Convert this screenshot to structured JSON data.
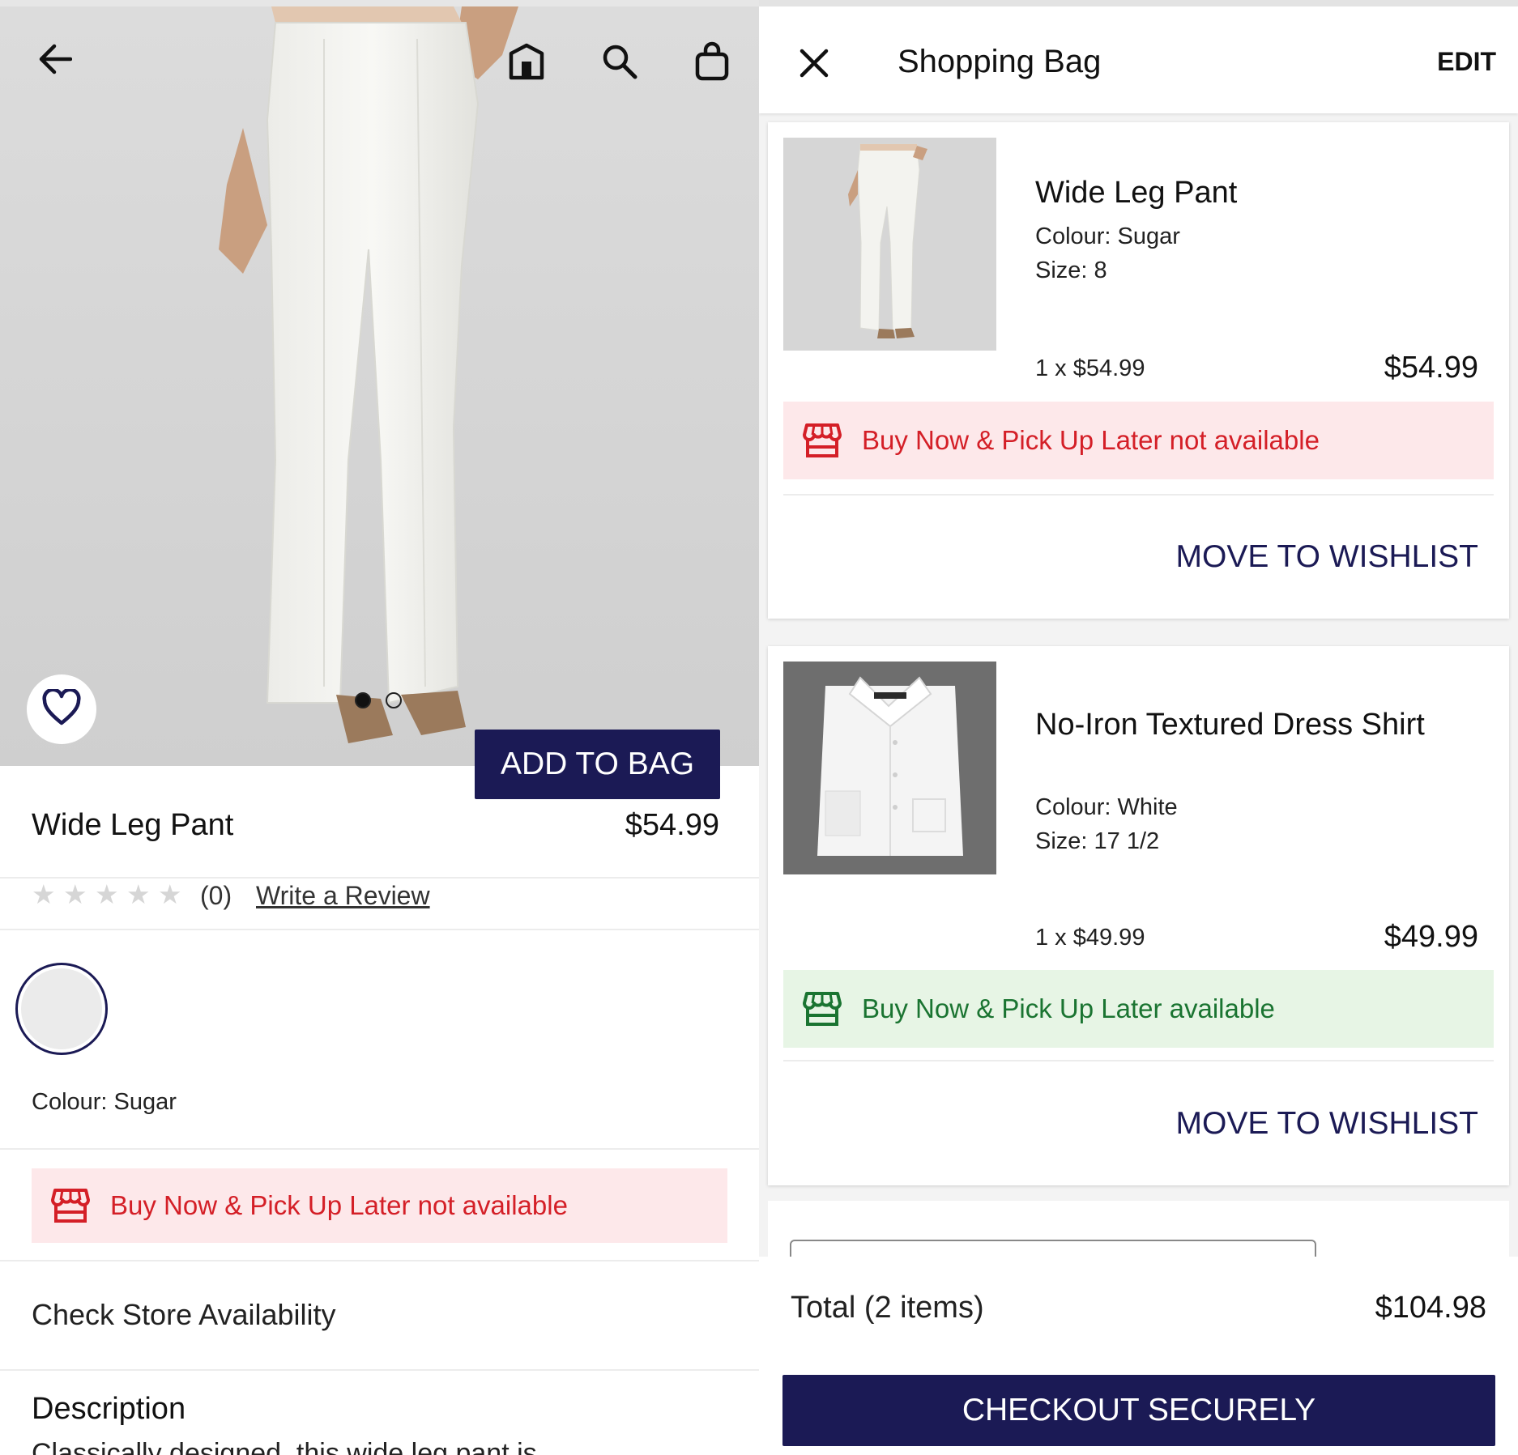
{
  "product_page": {
    "title": "Wide Leg Pant",
    "price": "$54.99",
    "rating": {
      "stars": 0,
      "max": 5,
      "count_text": "(0)",
      "write_review": "Write a Review"
    },
    "colour_label": "Colour: Sugar",
    "image_dots": {
      "count": 2,
      "active": 1
    },
    "add_to_bag": "ADD TO BAG",
    "bopis": "Buy Now & Pick Up Later not available",
    "check_store": "Check Store Availability",
    "description_heading": "Description",
    "description_text": "Classically designed, this wide leg pant is"
  },
  "bag": {
    "title": "Shopping Bag",
    "edit": "EDIT",
    "items": [
      {
        "name": "Wide Leg Pant",
        "colour": "Colour: Sugar",
        "size": "Size: 8",
        "unit_price": "1 x $54.99",
        "total": "$54.99",
        "bopis": "Buy Now & Pick Up Later not available",
        "bopis_status": "unavailable",
        "move_to_wishlist": "MOVE TO WISHLIST"
      },
      {
        "name": "No-Iron Textured Dress Shirt",
        "colour": "Colour: White",
        "size": "Size: 17 1/2",
        "unit_price": "1 x $49.99",
        "total": "$49.99",
        "bopis": "Buy Now & Pick Up Later available",
        "bopis_status": "available",
        "move_to_wishlist": "MOVE TO WISHLIST"
      }
    ],
    "total_label": "Total (2 items)",
    "total_value": "$104.98",
    "checkout": "CHECKOUT SECURELY"
  },
  "colors": {
    "brand_navy": "#1b1a55",
    "unavailable_bg": "#fde8ea",
    "unavailable_text": "#d41f27",
    "available_bg": "#e7f5e5",
    "available_text": "#1a7431"
  },
  "icons": [
    "back-arrow-icon",
    "store-icon",
    "search-icon",
    "bag-icon",
    "heart-icon",
    "close-icon",
    "store-front-icon",
    "star-icon"
  ]
}
